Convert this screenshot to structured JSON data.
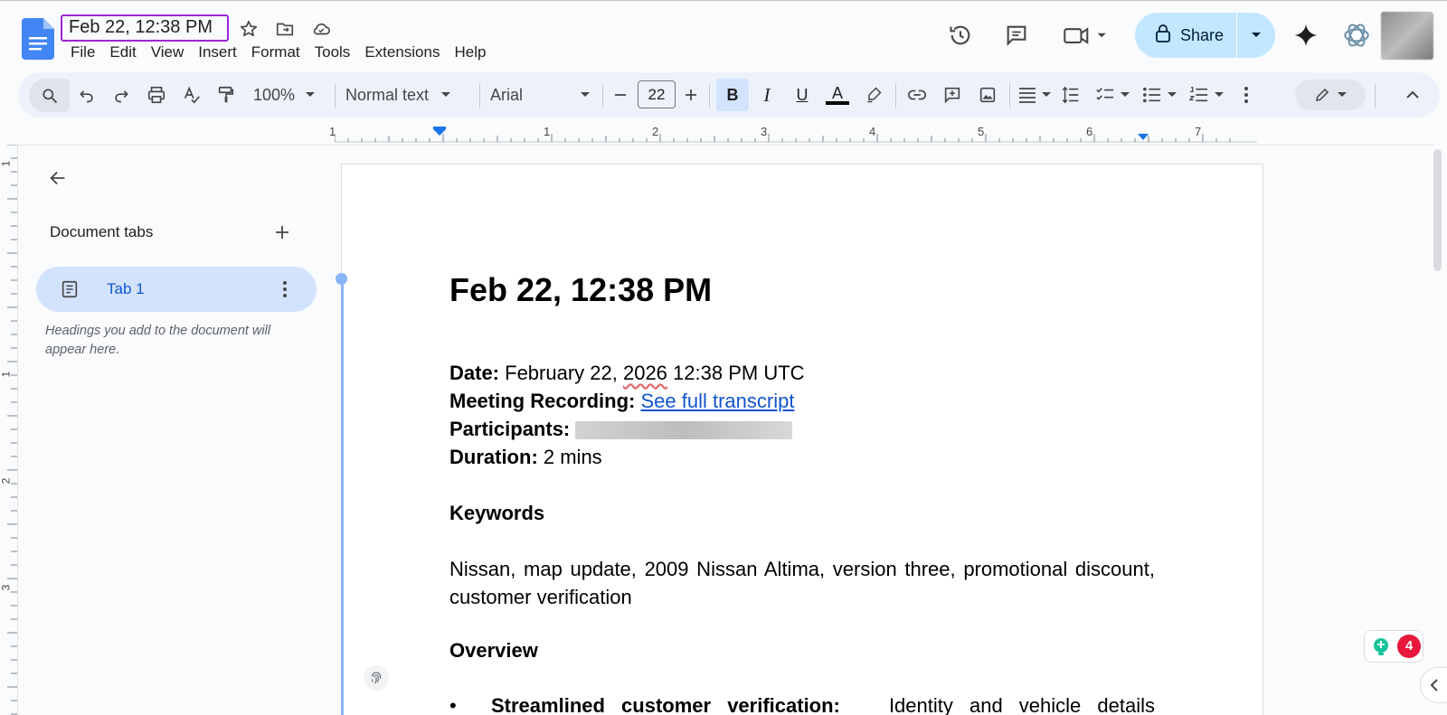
{
  "document": {
    "title": "Feb 22, 12:38 PM"
  },
  "menubar": [
    "File",
    "Edit",
    "View",
    "Insert",
    "Format",
    "Tools",
    "Extensions",
    "Help"
  ],
  "share": {
    "label": "Share"
  },
  "toolbar": {
    "zoom": "100%",
    "style": "Normal text",
    "font": "Arial",
    "font_size": "22",
    "bold": "B",
    "italic": "I",
    "underline": "U",
    "text_color": "A"
  },
  "ruler": {
    "numbers": [
      "1",
      "1",
      "2",
      "3",
      "4",
      "5",
      "6",
      "7"
    ]
  },
  "vruler": {
    "numbers": [
      "1",
      "1",
      "2",
      "3"
    ]
  },
  "sidebar": {
    "heading": "Document tabs",
    "tab_label": "Tab 1",
    "hint": "Headings you add to the document will appear here."
  },
  "content": {
    "heading": "Feb 22, 12:38 PM",
    "date_label": "Date:",
    "date_value_pre": " February 22, ",
    "date_year": "2026",
    "date_value_post": " 12:38 PM UTC",
    "recording_label": "Meeting Recording:",
    "recording_link": "See full transcript",
    "participants_label": "Participants:",
    "duration_label": "Duration:",
    "duration_value": " 2 mins",
    "keywords_heading": "Keywords",
    "keywords_text": "Nissan, map update, 2009 Nissan Altima, version three, promotional discount, customer verification",
    "overview_heading": "Overview",
    "bullet_bold": "Streamlined customer verification:",
    "bullet_text": " Identity and vehicle details"
  },
  "widget": {
    "badge_count": "4"
  },
  "colors": {
    "accent": "#0b57d0",
    "share_bg": "#c2e7ff",
    "title_highlight": "#9b26d6",
    "tab_active_bg": "#d3e3fd",
    "link": "#1155cc"
  }
}
